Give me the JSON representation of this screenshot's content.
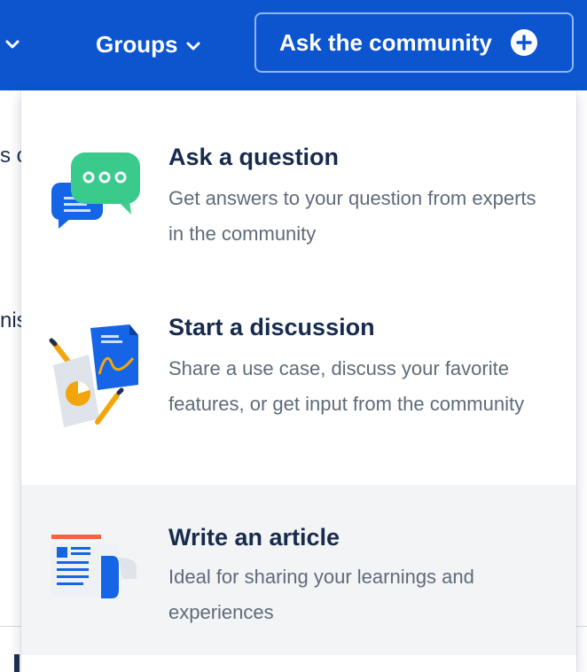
{
  "header": {
    "groups_label": "Groups",
    "ask_button_label": "Ask the community",
    "brand_color": "#0c55cf"
  },
  "background": {
    "frag1": "s c",
    "frag2": "nis"
  },
  "menu": {
    "items": [
      {
        "title": "Ask a question",
        "description": "Get answers to your question from experts in the community",
        "icon": "chat-bubbles-icon"
      },
      {
        "title": "Start a discussion",
        "description": "Share a use case, discuss your favorite features, or get input from the community",
        "icon": "documents-pencils-icon"
      },
      {
        "title": "Write an article",
        "description": "Ideal for sharing your learnings and experiences",
        "icon": "article-icon"
      }
    ]
  }
}
